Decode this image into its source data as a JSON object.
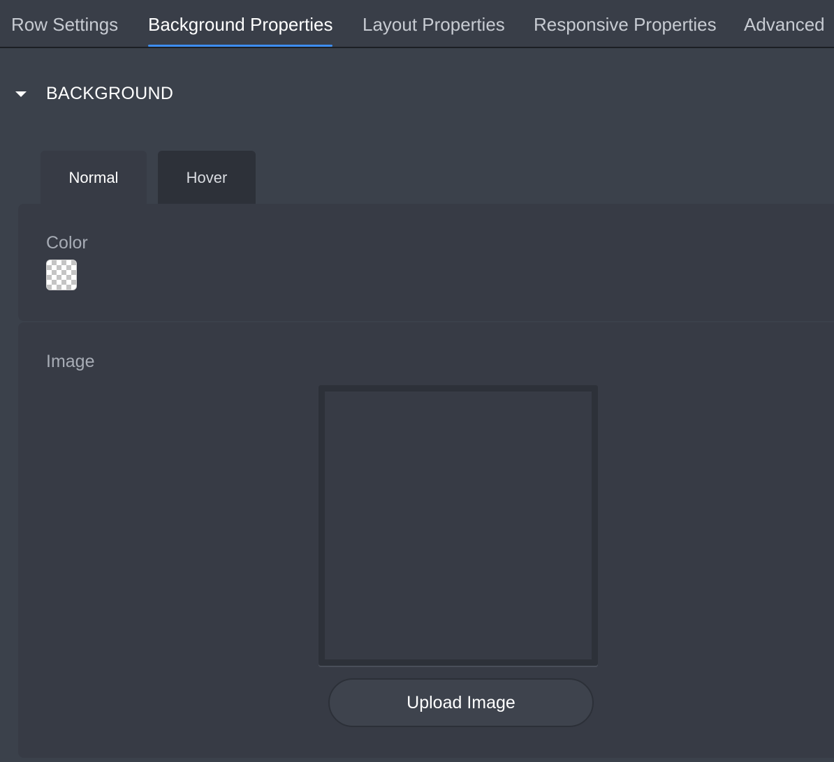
{
  "tabs": [
    {
      "label": "Row Settings",
      "active": false
    },
    {
      "label": "Background Properties",
      "active": true
    },
    {
      "label": "Layout Properties",
      "active": false
    },
    {
      "label": "Responsive Properties",
      "active": false
    },
    {
      "label": "Advanced",
      "active": false
    }
  ],
  "section": {
    "title": "BACKGROUND",
    "expanded": true,
    "toggle_icon": "caret-down-icon"
  },
  "state_tabs": [
    {
      "label": "Normal",
      "active": true
    },
    {
      "label": "Hover",
      "active": false
    }
  ],
  "color_field": {
    "label": "Color",
    "value_icon": "transparent-checkerboard"
  },
  "image_field": {
    "label": "Image",
    "upload_label": "Upload Image"
  },
  "theme": {
    "accent": "#3e8ef0",
    "background": "#3b414b",
    "panel": "#373b45",
    "text": "#ffffff",
    "muted_text": "#a7acb5"
  }
}
